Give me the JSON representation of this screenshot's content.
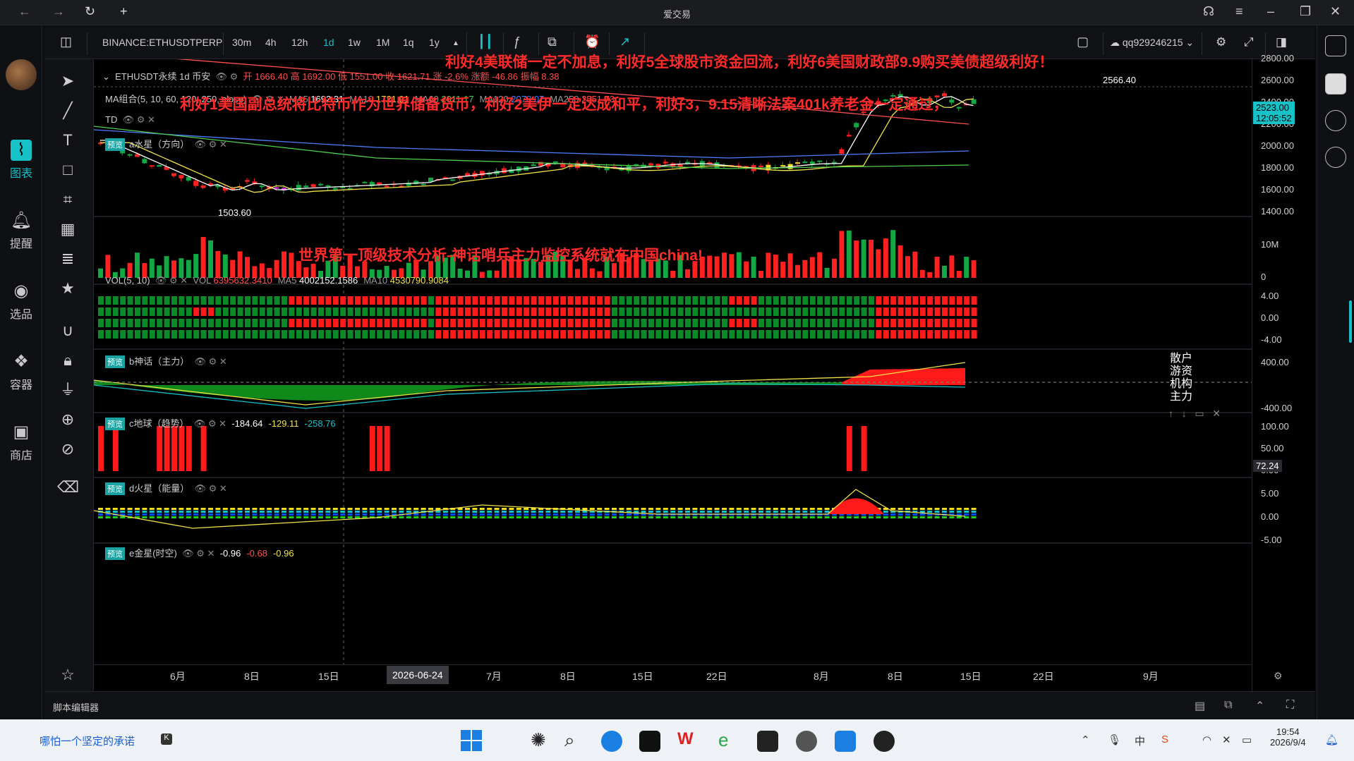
{
  "app": {
    "title": "爱交易"
  },
  "toolbar": {
    "symbol": "BINANCE:ETHUSDTPERP",
    "intervals": [
      "30m",
      "4h",
      "12h",
      "1d",
      "1w",
      "1M",
      "1q",
      "1y"
    ],
    "active_interval": "1d",
    "user": "qq929246215"
  },
  "leftbar": {
    "items": [
      {
        "label": "图表",
        "icon": "chart-icon",
        "active": true
      },
      {
        "label": "提醒",
        "icon": "bell-icon"
      },
      {
        "label": "选品",
        "icon": "scan-icon"
      },
      {
        "label": "容器",
        "icon": "container-icon"
      },
      {
        "label": "商店",
        "icon": "shop-icon"
      }
    ]
  },
  "main_pane": {
    "header": "ETHUSDT永续 1d 币安",
    "ohlc": "开 1666.40 高 1692.00 低 1551.00 收 1621.71 涨 -2.6% 涨额 -46.86 振幅 8.38",
    "ma_label": "MA组合(5, 10, 60, 120, 250, close)",
    "ma_values": [
      {
        "k": "MA5",
        "v": "1692.31",
        "c": "#ffffff"
      },
      {
        "k": "MA10",
        "v": "1721.91",
        "c": "#f0e34a"
      },
      {
        "k": "MA60",
        "v": "2011.17",
        "c": "#4fcf4f"
      },
      {
        "k": "MA120",
        "v": "2078.07",
        "c": "#4f7cff"
      },
      {
        "k": "MA250",
        "v": "2551.73",
        "c": "#ff4f4f"
      }
    ],
    "td_label": "TD",
    "a_label": "a水星（方向）",
    "low_label": "1503.60",
    "high_label": "2566.40",
    "y_ticks": [
      "2800.00",
      "2600.00",
      "2400.00",
      "2200.00",
      "2000.00",
      "1800.00",
      "1600.00",
      "1400.00"
    ],
    "price_tag": "2523.00",
    "countdown": "12:05:52"
  },
  "overlay_text": {
    "line1": "利好4美联储一定不加息，利好5全球股市资金回流，利好6美国财政部9.9购买美债超级利好！",
    "line2": "利好1美国副总统将比特币作为世界储备货币，利好2美伊一定达成和平，利好3，9.15清晰法案401k养老金一定通过，",
    "line3": "世界第一顶级技术分析-神话哨兵主力监控系统就在中国china!"
  },
  "vol_pane": {
    "label": "VOL(5, 10)",
    "values": [
      {
        "k": "VOL",
        "v": "6395632.3410",
        "c": "#ff5050"
      },
      {
        "k": "MA5",
        "v": "4002152.1586",
        "c": "#ffffff"
      },
      {
        "k": "MA10",
        "v": "4530790.9084",
        "c": "#f0e34a"
      }
    ],
    "y_ticks": [
      "10M",
      "0"
    ]
  },
  "b_pane": {
    "label": "b神话（主力）",
    "row_labels": [
      "散户",
      "游资",
      "机构",
      "主力"
    ],
    "y_ticks": [
      "4.00",
      "0.00",
      "-4.00"
    ]
  },
  "c_pane": {
    "label": "c地球（趋势）",
    "values": [
      {
        "v": "-184.64",
        "c": "#ffffff"
      },
      {
        "v": "-129.11",
        "c": "#f0e34a"
      },
      {
        "v": "-258.76",
        "c": "#17c1c8"
      }
    ],
    "y_ticks": [
      "400.00",
      "-400.00"
    ],
    "tag": "72.24"
  },
  "d_pane": {
    "label": "d火星（能量）",
    "y_ticks": [
      "100.00",
      "50.00",
      "0.00"
    ]
  },
  "e_pane": {
    "label": "e金星(时空)",
    "values": [
      {
        "v": "-0.96",
        "c": "#ffffff"
      },
      {
        "v": "-0.68",
        "c": "#ff5050"
      },
      {
        "v": "-0.96",
        "c": "#f0e34a"
      }
    ],
    "y_ticks": [
      "5.00",
      "0.00",
      "-5.00"
    ]
  },
  "x_axis": {
    "labels": [
      "6月",
      "8日",
      "15日",
      "2026-06-24",
      "7月",
      "8日",
      "15日",
      "22日",
      "8月",
      "8日",
      "15日",
      "22日",
      "9月"
    ],
    "cursor": "2026-06-24"
  },
  "bottom": {
    "script_editor": "脚本编辑器"
  },
  "taskbar": {
    "slogan": "哪怕一个坚定的承诺",
    "time": "19:54",
    "date": "2026/9/4"
  },
  "colors": {
    "up": "#ff2020",
    "down": "#13a843",
    "accent": "#17c1c8"
  }
}
